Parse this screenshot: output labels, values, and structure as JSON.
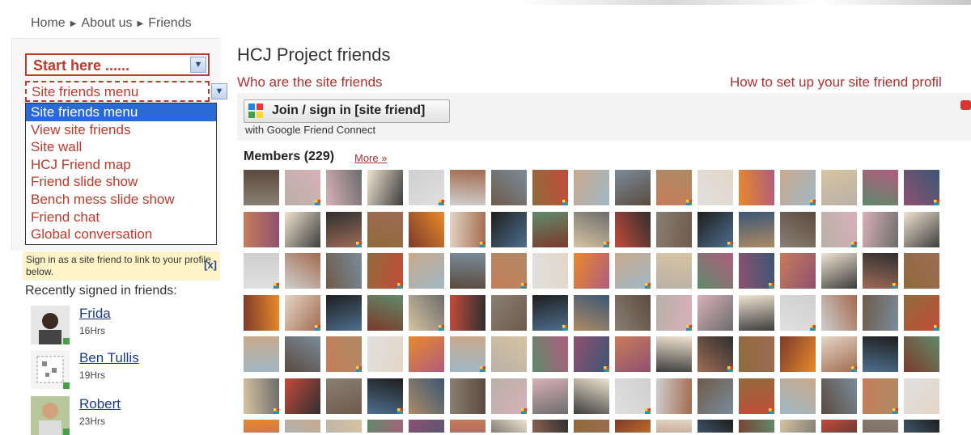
{
  "breadcrumb": [
    "Home",
    "About us",
    "Friends"
  ],
  "left": {
    "start_select": "Start here ......",
    "menu_select": "Site friends menu",
    "menu_options": [
      "Site friends menu",
      "View site friends",
      "Site wall",
      "HCJ Friend map",
      "Friend slide show",
      "Bench mess slide show",
      "Friend chat",
      "Global conversation"
    ],
    "selected_option": "Site friends menu",
    "signin_note": "Sign in as a site friend to link to your profile below.",
    "signin_close": "[x]",
    "recent_title": "Recently signed in friends:",
    "recent_friends": [
      {
        "name": "Frida",
        "time": "16Hrs"
      },
      {
        "name": "Ben Tullis",
        "time": "19Hrs"
      },
      {
        "name": "Robert",
        "time": "23Hrs"
      }
    ]
  },
  "main": {
    "title": "HCJ Project friends",
    "link_who": "Who are the site friends",
    "link_how": "How to set up your site friend profil",
    "join_button": "Join / sign in [site friend]",
    "gfc_note": "with Google Friend Connect",
    "members_title": "Members (229)",
    "more_link": "More »"
  },
  "colors": {
    "accent_red": "#c0392b",
    "link_red": "#b03030",
    "link_blue": "#1a3b8b",
    "selected_blue": "#2a6ad5"
  },
  "icons": [
    "chevron-down-icon",
    "google-friend-connect-icon",
    "close-icon",
    "member-avatar"
  ]
}
